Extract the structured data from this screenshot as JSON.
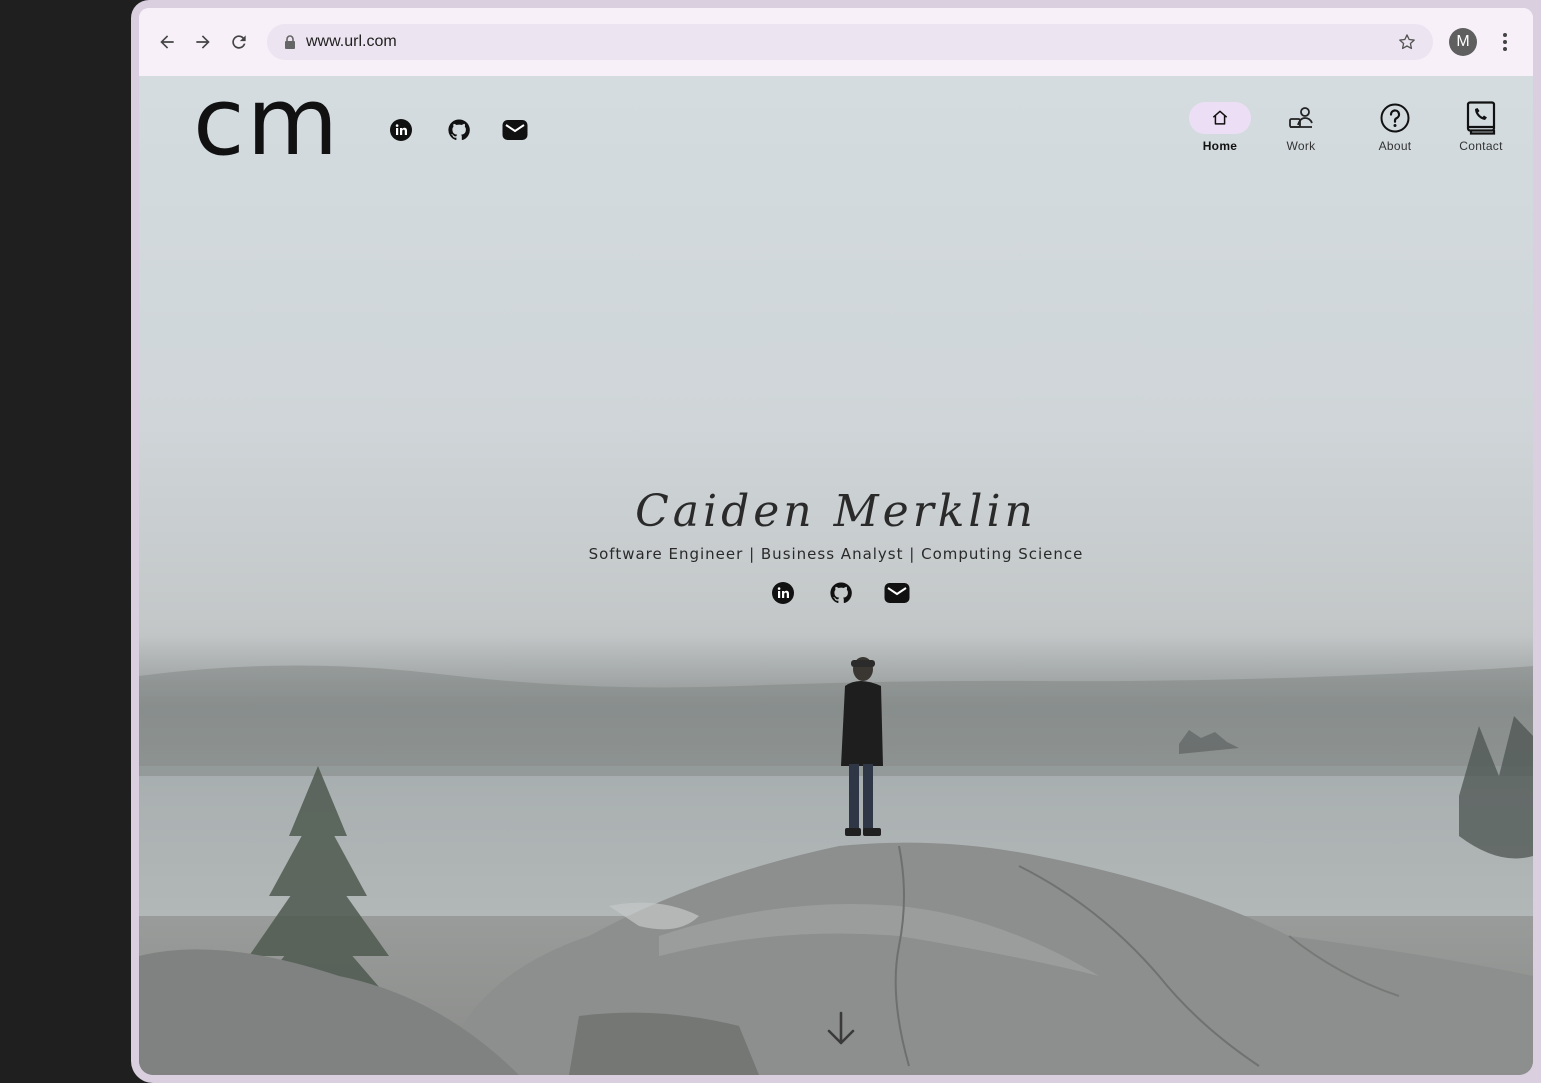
{
  "browser": {
    "url": "www.url.com",
    "profile_initial": "M"
  },
  "site": {
    "logo_text": "cm",
    "social_links": [
      {
        "name": "linkedin",
        "icon": "linkedin-icon"
      },
      {
        "name": "github",
        "icon": "github-icon"
      },
      {
        "name": "email",
        "icon": "mail-icon"
      }
    ],
    "nav": [
      {
        "label": "Home",
        "icon": "home-icon",
        "active": true
      },
      {
        "label": "Work",
        "icon": "work-icon",
        "active": false
      },
      {
        "label": "About",
        "icon": "help-circle-icon",
        "active": false
      },
      {
        "label": "Contact",
        "icon": "contact-book-icon",
        "active": false
      }
    ],
    "hero": {
      "name": "Caiden  Merklin",
      "subtitle": "Software Engineer | Business Analyst | Computing Science"
    }
  },
  "colors": {
    "nav_active_bg": "#ecdff5",
    "toolbar_bg": "#f7f0f9",
    "icon_color": "#111111"
  }
}
